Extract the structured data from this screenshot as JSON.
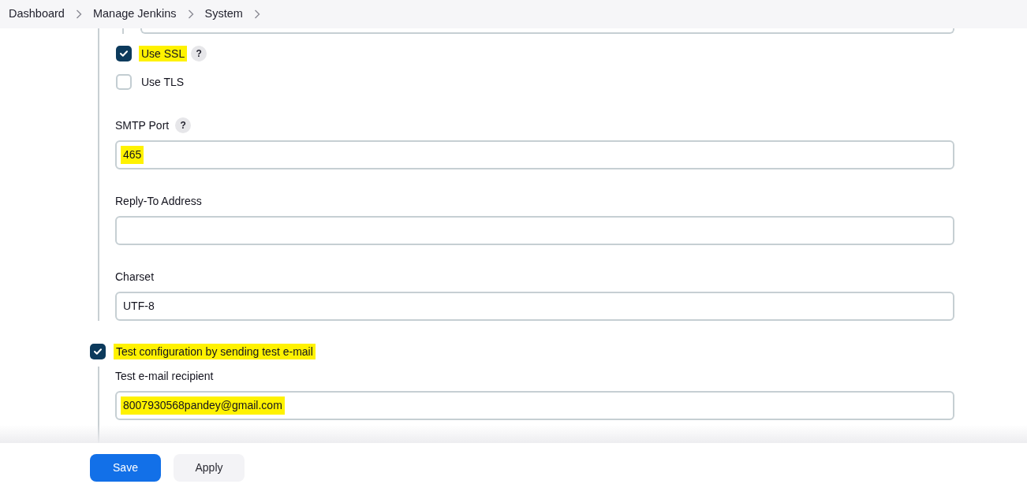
{
  "breadcrumb": [
    {
      "label": "Dashboard"
    },
    {
      "label": "Manage Jenkins"
    },
    {
      "label": "System"
    }
  ],
  "options": [
    {
      "kind": "checkbox",
      "label": "Use SSL",
      "checked": true,
      "highlighted": true,
      "help": "?"
    },
    {
      "kind": "checkbox",
      "label": "Use TLS",
      "checked": false,
      "highlighted": false
    },
    {
      "kind": "field",
      "label": "SMTP Port",
      "help": "?",
      "value": "465",
      "highlighted": true
    },
    {
      "kind": "field",
      "label": "Reply-To Address",
      "highlighted": false
    },
    {
      "kind": "field",
      "label": "Charset",
      "value": "UTF-8",
      "highlighted": false
    }
  ],
  "test_section": {
    "label": "Test configuration by sending test e-mail",
    "checked": true,
    "highlighted": true,
    "fields": [
      {
        "label": "Test e-mail recipient",
        "value": "8007930568pandey@gmail.com",
        "highlighted": true
      }
    ]
  },
  "buttons": [
    {
      "kind": "primary",
      "label": "Save"
    },
    {
      "kind": "secondary",
      "label": "Apply"
    }
  ]
}
